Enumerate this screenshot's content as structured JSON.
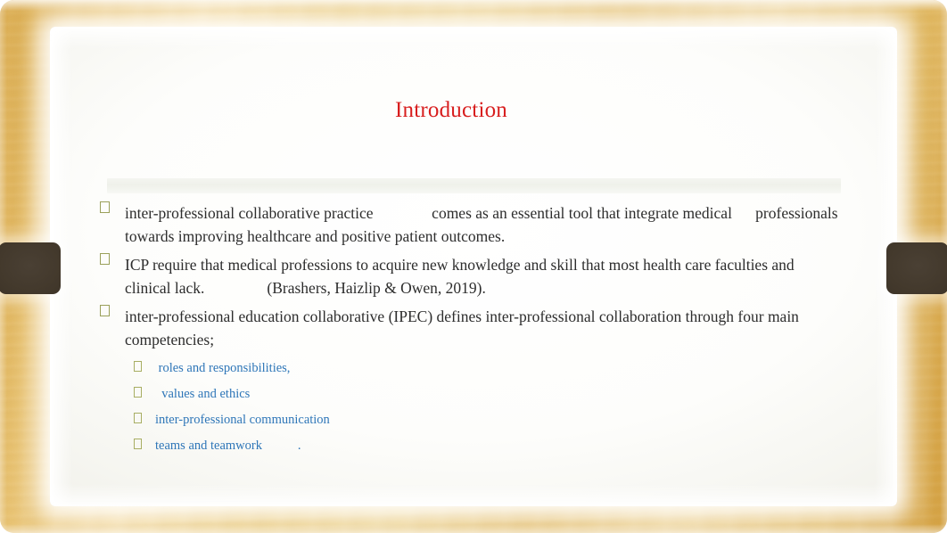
{
  "slide": {
    "title": "Introduction",
    "title_color": "#d81e1e",
    "frame_color": "#e8c271",
    "side_tab_color": "#43392c",
    "bullet_glyph_color": "#9aa05a",
    "sub_bullet_text_color": "#2e76b8",
    "body_text_color": "#2d2d2d"
  },
  "bullets": [
    {
      "glyph": "missing-glyph-box",
      "text": "inter-professional collaborative practice               comes as an essential tool that integrate medical      professionals towards improving healthcare and positive patient outcomes."
    },
    {
      "glyph": "missing-glyph-box",
      "text": "ICP require that medical professions to acquire new knowledge and skill that most health care faculties and clinical lack.                (Brashers, Haizlip & Owen, 2019)."
    },
    {
      "glyph": "missing-glyph-box",
      "text": "inter-professional education collaborative (IPEC) defines inter-professional collaboration through four main competencies;"
    }
  ],
  "sub_bullets": [
    {
      "glyph": "missing-glyph-box",
      "text": " roles and responsibilities,"
    },
    {
      "glyph": "missing-glyph-box",
      "text": "  values and ethics"
    },
    {
      "glyph": "missing-glyph-box",
      "text": "inter-professional communication"
    },
    {
      "glyph": "missing-glyph-box",
      "text": "teams and teamwork           ."
    }
  ]
}
